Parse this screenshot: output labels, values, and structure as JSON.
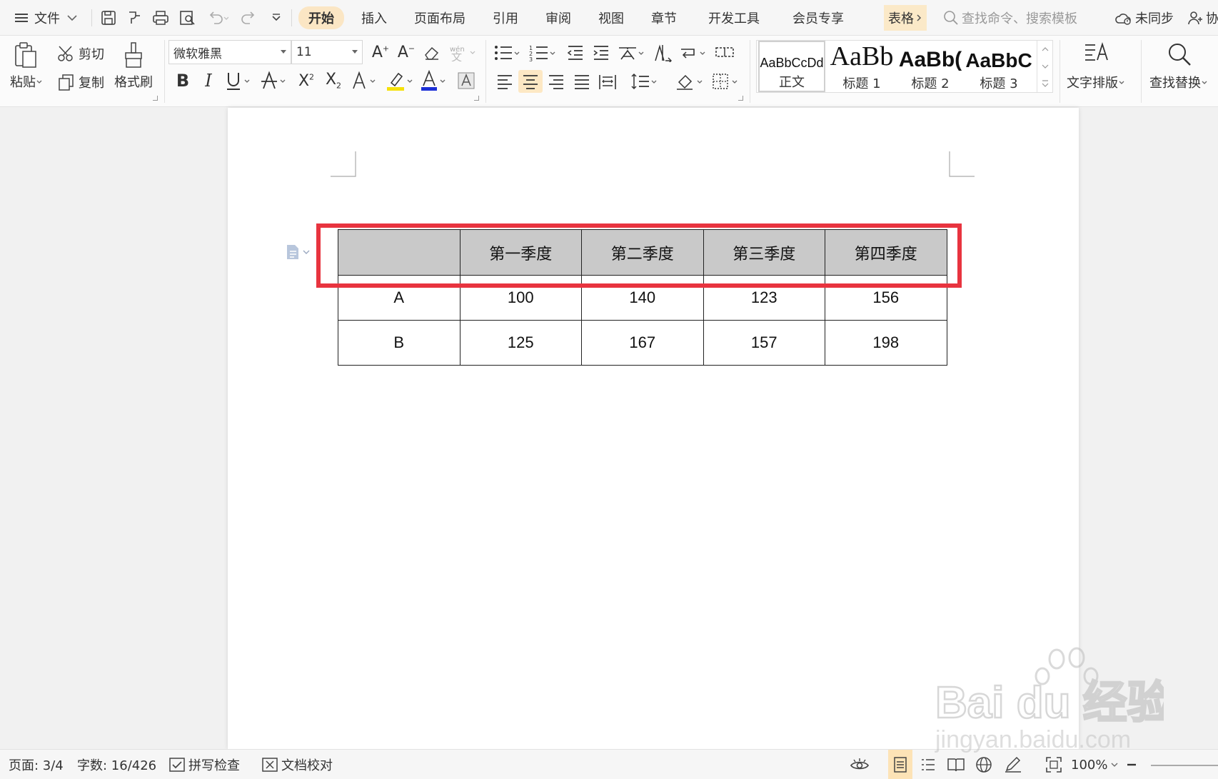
{
  "toolbar": {
    "menu_label": "文件",
    "tabs": [
      "开始",
      "插入",
      "页面布局",
      "引用",
      "审阅",
      "视图",
      "章节",
      "开发工具",
      "会员专享",
      "表格"
    ],
    "search_placeholder": "查找命令、搜索模板",
    "sync_label": "未同步",
    "collab_label": "协"
  },
  "ribbon": {
    "paste": "粘贴",
    "cut": "剪切",
    "copy": "复制",
    "format_painter": "格式刷",
    "font_name": "微软雅黑",
    "font_size": "11",
    "styles": [
      {
        "preview": "AaBbCcDd",
        "name": "正文"
      },
      {
        "preview": "AaBb",
        "name": "标题 1"
      },
      {
        "preview": "AaBb(",
        "name": "标题 2"
      },
      {
        "preview": "AaBbC",
        "name": "标题 3"
      }
    ],
    "text_layout": "文字排版",
    "find_replace": "查找替换"
  },
  "document": {
    "table": {
      "headers": [
        "",
        "第一季度",
        "第二季度",
        "第三季度",
        "第四季度"
      ],
      "rows": [
        [
          "A",
          "100",
          "140",
          "123",
          "156"
        ],
        [
          "B",
          "125",
          "167",
          "157",
          "198"
        ]
      ]
    }
  },
  "statusbar": {
    "page": "页面: 3/4",
    "words": "字数: 16/426",
    "spell_check": "拼写检查",
    "proofread": "文档校对",
    "zoom": "100%"
  },
  "watermark": {
    "brand": "Bai du 经验",
    "url": "jingyan.baidu.com"
  },
  "colors": {
    "accent_tab_bg": "#fbe6c4",
    "highlight_border": "#e8343f",
    "table_header_bg": "#c9c9c9"
  }
}
